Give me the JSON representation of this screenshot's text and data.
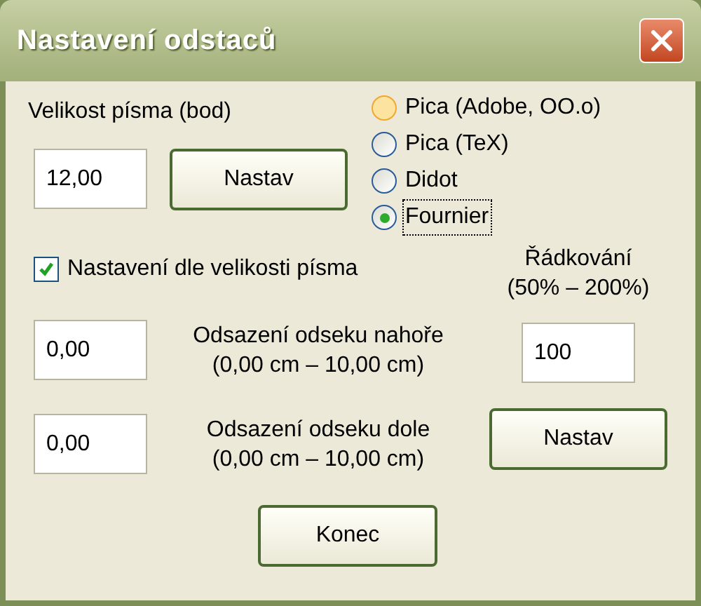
{
  "window": {
    "title": "Nastavení odstaců"
  },
  "font_size": {
    "label": "Velikost písma (bod)",
    "value": "12,00",
    "button": "Nastav"
  },
  "units": [
    {
      "label": "Pica (Adobe, OO.o)",
      "selected": false,
      "hovered": true,
      "focused": false
    },
    {
      "label": "Pica (TeX)",
      "selected": false,
      "hovered": false,
      "focused": false
    },
    {
      "label": "Didot",
      "selected": false,
      "hovered": false,
      "focused": false
    },
    {
      "label": "Fournier",
      "selected": true,
      "hovered": false,
      "focused": true
    }
  ],
  "by_font_size": {
    "label": "Nastavení dle velikosti písma",
    "checked": true
  },
  "line_spacing": {
    "label": "Řádkování",
    "range": "(50% – 200%)",
    "value": "100",
    "button": "Nastav"
  },
  "indent_top": {
    "value": "0,00",
    "label": "Odsazení odseku nahoře",
    "range": "(0,00 cm – 10,00 cm)"
  },
  "indent_bottom": {
    "value": "0,00",
    "label": "Odsazení odseku dole",
    "range": "(0,00 cm – 10,00 cm)"
  },
  "close_button": "Konec"
}
